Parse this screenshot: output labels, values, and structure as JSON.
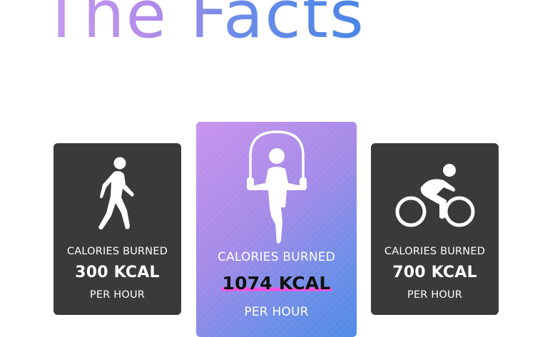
{
  "heading": "The Facts",
  "cards": [
    {
      "icon": "walking-person-icon",
      "line1": "CALORIES BURNED",
      "value": "300 KCAL",
      "line3": "PER HOUR"
    },
    {
      "icon": "jump-rope-icon",
      "line1": "CALORIES BURNED",
      "value": "1074 KCAL",
      "line3": "PER HOUR"
    },
    {
      "icon": "cycling-icon",
      "line1": "CALORIES BURNED",
      "value": "700 KCAL",
      "line3": "PER HOUR"
    }
  ],
  "colors": {
    "card_dark": "#3a3a3a",
    "gradient_start": "#c894ee",
    "gradient_end": "#4f8be6",
    "highlight": "#ff4fe0"
  }
}
